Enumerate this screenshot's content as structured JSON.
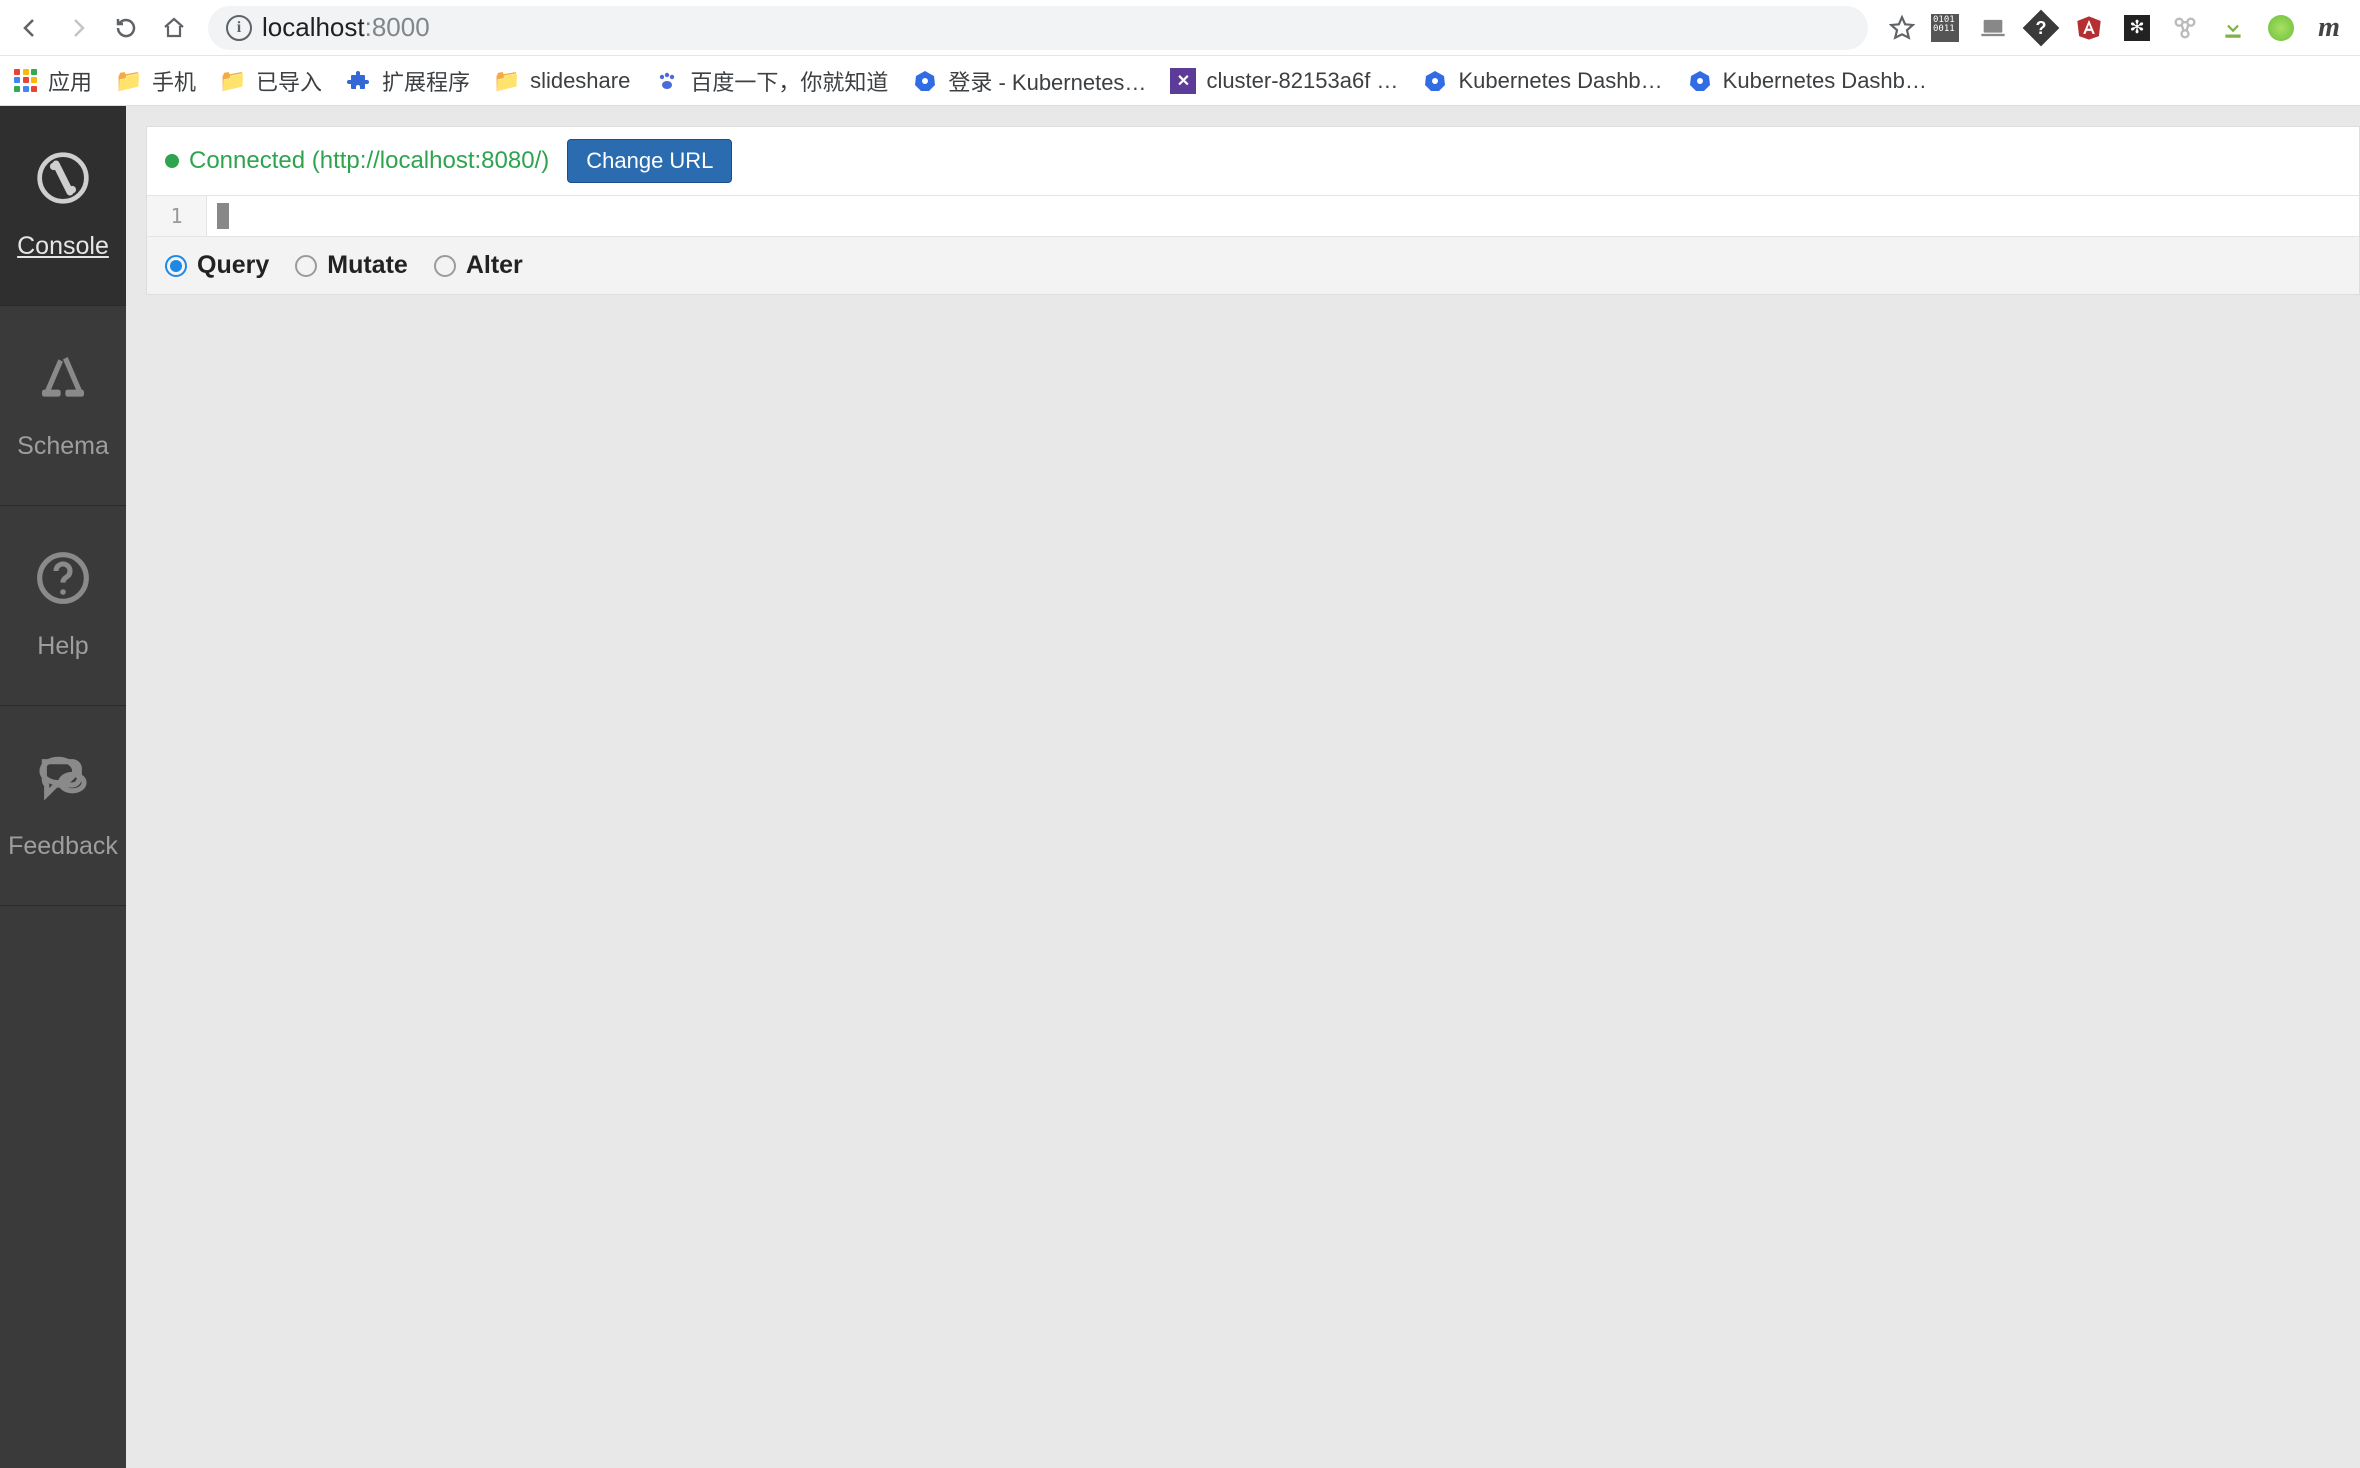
{
  "browser": {
    "url_host": "localhost",
    "url_port": ":8000"
  },
  "bookmarks": {
    "apps": "应用",
    "items": [
      {
        "icon": "folder",
        "label": "手机"
      },
      {
        "icon": "folder",
        "label": "已导入"
      },
      {
        "icon": "puzzle",
        "label": "扩展程序"
      },
      {
        "icon": "folder",
        "label": "slideshare"
      },
      {
        "icon": "paw",
        "label": "百度一下，你就知道"
      },
      {
        "icon": "k8s",
        "label": "登录 - Kubernetes…"
      },
      {
        "icon": "xbox",
        "label": "cluster-82153a6f …"
      },
      {
        "icon": "k8s",
        "label": "Kubernetes Dashb…"
      },
      {
        "icon": "k8s",
        "label": "Kubernetes Dashb…"
      }
    ]
  },
  "sidebar": {
    "items": [
      {
        "label": "Console"
      },
      {
        "label": "Schema"
      },
      {
        "label": "Help"
      },
      {
        "label": "Feedback"
      }
    ]
  },
  "panel": {
    "status_text": "Connected (http://localhost:8080/)",
    "change_url_label": "Change URL",
    "line_number": "1",
    "radios": {
      "query": "Query",
      "mutate": "Mutate",
      "alter": "Alter"
    }
  }
}
